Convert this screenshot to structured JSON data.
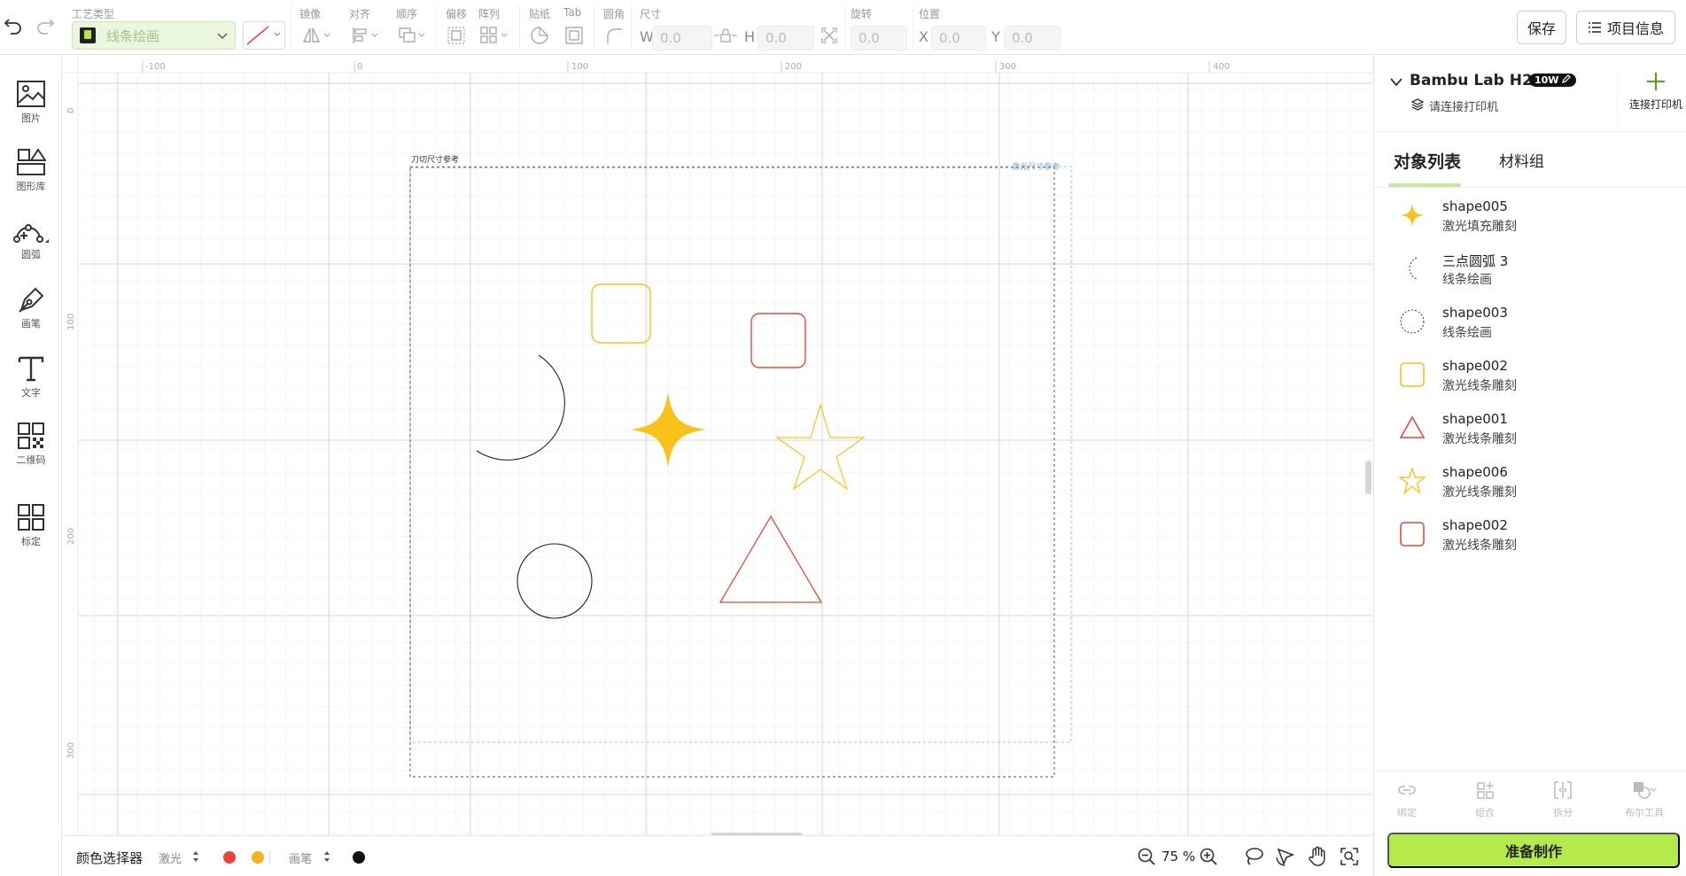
{
  "toolbar": {
    "undo": "undo-icon",
    "redo": "redo-icon",
    "process_type_label": "工艺类型",
    "process_type_value": "线条绘画",
    "group_labels": [
      "镜像",
      "对齐",
      "顺序",
      "偏移",
      "阵列",
      "贴纸",
      "Tab",
      "圆角",
      "尺寸",
      "旋转",
      "位置"
    ],
    "width_letter": "W",
    "height_letter": "H",
    "x_letter": "X",
    "y_letter": "Y",
    "width_value": "0.0",
    "height_value": "0.0",
    "rotation_value": "0.0",
    "x_value": "0.0",
    "y_value": "0.0",
    "save_label": "保存",
    "project_info_label": "项目信息"
  },
  "left_tools": [
    {
      "label": "图片",
      "icon": "image-icon"
    },
    {
      "label": "图形库",
      "icon": "shape-library-icon"
    },
    {
      "label": "圆弧",
      "icon": "arc-icon"
    },
    {
      "label": "画笔",
      "icon": "pen-icon"
    },
    {
      "label": "文字",
      "icon": "text-icon"
    },
    {
      "label": "二维码",
      "icon": "qrcode-icon"
    },
    {
      "label": "标定",
      "icon": "calibrate-icon"
    }
  ],
  "canvas": {
    "ruler_h": [
      "-100",
      "0",
      "100",
      "200",
      "300",
      "400"
    ],
    "ruler_v": [
      "0",
      "100",
      "200",
      "300"
    ],
    "cut_label": "刀切尺寸参考",
    "laser_label": "激光尺寸参考",
    "colors": {
      "yellow": "#f8c21b",
      "red": "#d94f3d",
      "black": "#222222",
      "laser_blue": "#8fb8e0"
    }
  },
  "bottom": {
    "color_picker_label": "颜色选择器",
    "laser_label": "激光",
    "pen_label": "画笔",
    "laser_colors": [
      "#e8443a",
      "#f5b321"
    ],
    "pen_colors": [
      "#111111"
    ],
    "zoom": "75 %"
  },
  "right_panel": {
    "printer_name": "Bambu Lab H2D",
    "printer_power": "10W",
    "printer_status": "请连接打印机",
    "connect_label": "连接打印机",
    "tabs": [
      {
        "label": "对象列表",
        "active": true
      },
      {
        "label": "材料组",
        "active": false
      }
    ],
    "objects": [
      {
        "name": "shape005",
        "type": "激光填充雕刻",
        "icon": "sparkle-fill-icon"
      },
      {
        "name": "三点圆弧 3",
        "type": "线条绘画",
        "icon": "arc-icon"
      },
      {
        "name": "shape003",
        "type": "线条绘画",
        "icon": "circle-icon"
      },
      {
        "name": "shape002",
        "type": "激光线条雕刻",
        "icon": "rounded-square-icon"
      },
      {
        "name": "shape001",
        "type": "激光线条雕刻",
        "icon": "triangle-icon"
      },
      {
        "name": "shape006",
        "type": "激光线条雕刻",
        "icon": "star-icon"
      },
      {
        "name": "shape002",
        "type": "激光线条雕刻",
        "icon": "rounded-square-red-icon"
      }
    ],
    "bottom_tools": [
      "绑定",
      "组合",
      "拆分",
      "布尔工具"
    ],
    "prepare_label": "准备制作"
  }
}
